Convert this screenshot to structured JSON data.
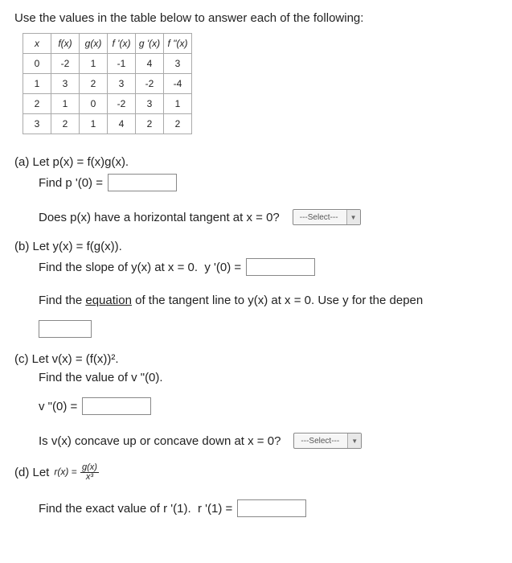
{
  "intro": "Use the values in the table below to answer each of the following:",
  "table": {
    "headers": [
      "x",
      "f(x)",
      "g(x)",
      "f '(x)",
      "g '(x)",
      "f \"(x)"
    ],
    "rows": [
      [
        "0",
        "-2",
        "1",
        "-1",
        "4",
        "3"
      ],
      [
        "1",
        "3",
        "2",
        "3",
        "-2",
        "-4"
      ],
      [
        "2",
        "1",
        "0",
        "-2",
        "3",
        "1"
      ],
      [
        "3",
        "2",
        "1",
        "4",
        "2",
        "2"
      ]
    ]
  },
  "selectPlaceholder": "---Select---",
  "parts": {
    "a": {
      "def": "(a) Let p(x) = f(x)g(x).",
      "find": "Find p '(0) = ",
      "horiz": "Does p(x) have a horizontal tangent at x = 0?"
    },
    "b": {
      "def": "(b) Let y(x) = f(g(x)).",
      "find": "Find the slope of y(x) at x = 0.  y '(0) = ",
      "tangent_pre": "Find the ",
      "tangent_underlined": "equation",
      "tangent_post": " of the tangent line to y(x) at x = 0. Use y for the depen"
    },
    "c": {
      "def": "(c) Let v(x) = (f(x))².",
      "find": "Find the value of v \"(0).",
      "expr": "v \"(0) = ",
      "concave": "Is v(x) concave up or concave down at x = 0?"
    },
    "d": {
      "def_pre": "(d) Let ",
      "rx": "r(x) = ",
      "frac_num": "g(x)",
      "frac_den": "x³",
      "find": "Find the exact value of r '(1).  r '(1) = "
    }
  }
}
